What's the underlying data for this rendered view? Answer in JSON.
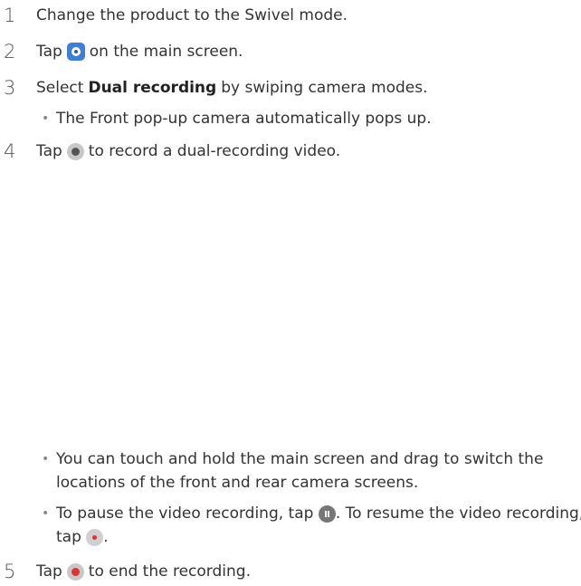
{
  "steps": [
    {
      "num": "1",
      "text": "Change the product to the Swivel mode."
    },
    {
      "num": "2",
      "before": "Tap",
      "icon": "camera-app-icon",
      "after": "on the main screen."
    },
    {
      "num": "3",
      "before": "Select",
      "bold": "Dual recording",
      "after": "by swiping camera modes."
    },
    {
      "num": "4",
      "before": "Tap",
      "icon": "record-icon",
      "after": "to record a dual-recording video."
    },
    {
      "num": "5",
      "before": "Tap",
      "icon": "stop-icon",
      "after": "to end the recording."
    }
  ],
  "bullets": {
    "pop_up": "The Front pop-up camera automatically pops up.",
    "switch_line1": "You can touch and hold the main screen and drag to switch the",
    "switch_line2": "locations of the front and rear camera screens.",
    "pause_before": "To pause the video recording, tap",
    "pause_after": ". To resume the video recording,",
    "resume_before": "tap",
    "resume_after": "."
  },
  "colors": {
    "text": "#333333",
    "camera_icon": "#3d7fd6",
    "record_red": "#e03030"
  }
}
